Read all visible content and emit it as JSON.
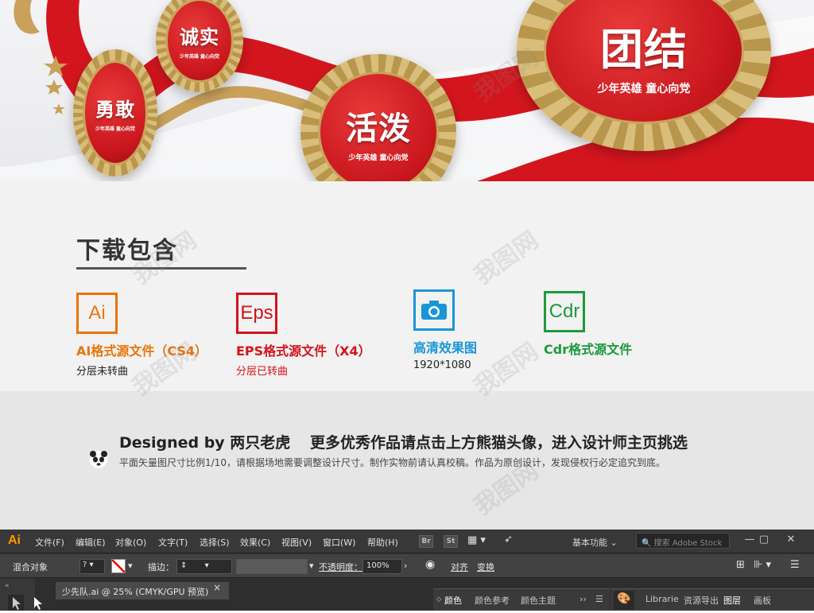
{
  "hero": {
    "medals": [
      {
        "big": "勇敢",
        "small": "少年英雄 童心向党"
      },
      {
        "big": "诚实",
        "small": "少年英雄 童心向党"
      },
      {
        "big": "活泼",
        "small": "少年英雄 童心向党"
      },
      {
        "big": "团结",
        "small": "少年英雄 童心向党"
      }
    ]
  },
  "downloads": {
    "title": "下载包含",
    "files": [
      {
        "icon_text": "Ai",
        "name": "AI格式源文件（CS4）",
        "sub": "分层未转曲",
        "color": "#e8750a"
      },
      {
        "icon_text": "Eps",
        "name": "EPS格式源文件（X4）",
        "sub": "分层已转曲",
        "color": "#d2141b"
      },
      {
        "icon": "camera-icon",
        "name": "高清效果图",
        "sub": "1920*1080",
        "color": "#1a96d6"
      },
      {
        "icon_text": "Cdr",
        "name": "Cdr格式源文件",
        "sub": "",
        "color": "#1d9a3c"
      }
    ]
  },
  "designer": {
    "by": "Designed by 两只老虎",
    "more": "更多优秀作品请点击上方熊猫头像，进入设计师主页挑选",
    "note": "平面矢量图尺寸比例1/10，请根据场地需要调整设计尺寸。制作实物前请认真校稿。作品为原创设计，发现侵权行必定追究到底。"
  },
  "illustrator": {
    "logo": "Ai",
    "menus": [
      "文件(F)",
      "编辑(E)",
      "对象(O)",
      "文字(T)",
      "选择(S)",
      "效果(C)",
      "视图(V)",
      "窗口(W)",
      "帮助(H)"
    ],
    "bridge": "Br",
    "stock": "St",
    "workspace": "基本功能",
    "search_placeholder": "搜索 Adobe Stock",
    "control": {
      "selection": "混合对象",
      "stroke_label": "描边：",
      "opacity_label": "不透明度：",
      "opacity_value": "100%",
      "align": "对齐",
      "transform": "变换"
    },
    "doc_tab": "少先队.ai @ 25% (CMYK/GPU 预览)",
    "panel1_tabs": [
      "颜色",
      "颜色参考",
      "颜色主题"
    ],
    "panel2_tabs": [
      "Librarie",
      "资源导出",
      "图层",
      "画板"
    ]
  },
  "colors": {
    "hero_red": "#c8161d",
    "gold": "#c8a45a",
    "ai_orange": "#ff9a00"
  }
}
